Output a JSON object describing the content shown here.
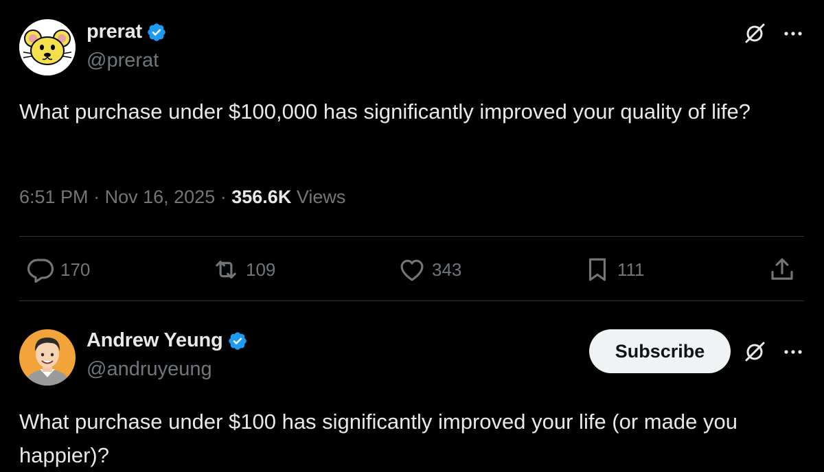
{
  "post1": {
    "author": {
      "display_name": "prerat",
      "handle": "@prerat",
      "verified": true,
      "avatar": "cartoon-rat-avatar"
    },
    "text": "What purchase under $100,000 has significantly improved your quality of life?",
    "time": "6:51 PM",
    "separator": "·",
    "date": "Nov 16, 2025",
    "views_count": "356.6K",
    "views_label": "Views",
    "actions": {
      "replies": "170",
      "reposts": "109",
      "likes": "343",
      "bookmarks": "111"
    }
  },
  "post2": {
    "author": {
      "display_name": "Andrew Yeung",
      "handle": "@andruyeung",
      "verified": true,
      "avatar": "cartoon-man-avatar"
    },
    "subscribe_label": "Subscribe",
    "text": "What purchase under $100 has significantly improved your life (or made you happier)?"
  },
  "icons": {
    "verified": "verified-badge-icon",
    "grok": "grok-icon",
    "more": "more-icon",
    "reply": "reply-icon",
    "repost": "repost-icon",
    "like": "heart-icon",
    "bookmark": "bookmark-icon",
    "share": "share-icon"
  },
  "colors": {
    "background": "#000000",
    "primary_text": "#e7e9ea",
    "secondary_text": "#71767b",
    "verified_blue": "#1d9bf0",
    "divider": "#2f3336",
    "button_bg": "#eff3f4"
  }
}
